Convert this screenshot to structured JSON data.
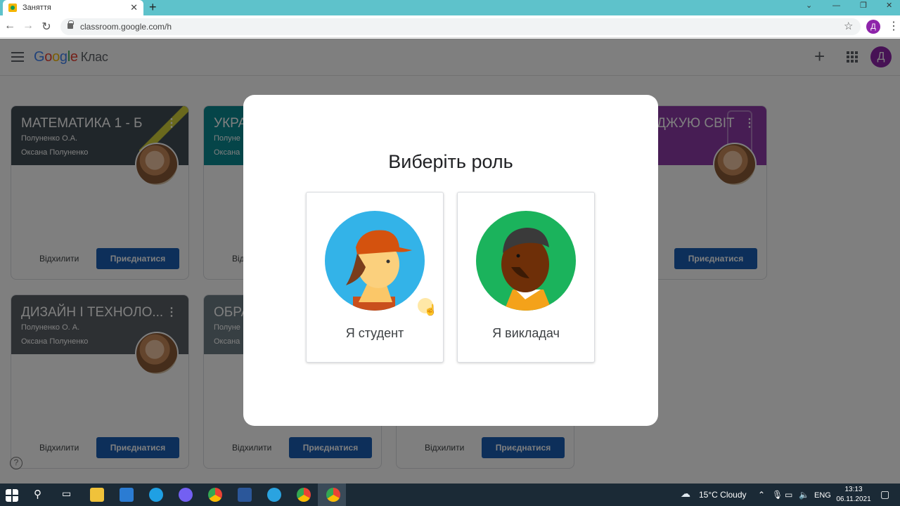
{
  "browser": {
    "tab_title": "Заняття",
    "tab_close": "✕",
    "new_tab": "+",
    "url": "classroom.google.com/h",
    "profile_initial": "Д",
    "window_controls": [
      "⌄",
      "—",
      "❐",
      "✕"
    ]
  },
  "app": {
    "logo_letters": [
      "G",
      "o",
      "o",
      "g",
      "l",
      "e"
    ],
    "product": "Клас",
    "avatar_initial": "Д",
    "plus": "+"
  },
  "courses": [
    {
      "title": "МАТЕМАТИКА 1 - Б",
      "teacher_short": "Полуненко О.А.",
      "teacher_full": "Оксана Полуненко",
      "color": "#414d55",
      "decline": "Відхилити",
      "join": "Приєднатися"
    },
    {
      "title": "УКРА",
      "teacher_short": "Полуне",
      "teacher_full": "Оксана",
      "color": "#0b8a93",
      "decline": "Від",
      "join": ""
    },
    {
      "title": "ДЖУЮ СВІТ",
      "teacher_short": "",
      "teacher_full": "",
      "color": "#8e3aa8",
      "decline": "и",
      "join": "Приєднатися"
    },
    {
      "title": "ДИЗАЙН І ТЕХНОЛО...",
      "teacher_short": "Полуненко О. А.",
      "teacher_full": "Оксана Полуненко",
      "color": "#5a6066",
      "decline": "Відхилити",
      "join": "Приєднатися"
    },
    {
      "title": "ОБРА",
      "teacher_short": "Полуне",
      "teacher_full": "Оксана",
      "color": "#6e7f86",
      "decline": "Відхилити",
      "join": "Приєднатися"
    },
    {
      "title": "",
      "teacher_short": "",
      "teacher_full": "",
      "color": "#ffffff",
      "decline": "Відхилити",
      "join": "Приєднатися"
    }
  ],
  "dialog": {
    "title": "Виберіть роль",
    "student_label": "Я студент",
    "teacher_label": "Я викладач"
  },
  "taskbar": {
    "weather": "15°C  Cloudy",
    "lang": "ENG",
    "time": "13:13",
    "date": "06.11.2021"
  }
}
